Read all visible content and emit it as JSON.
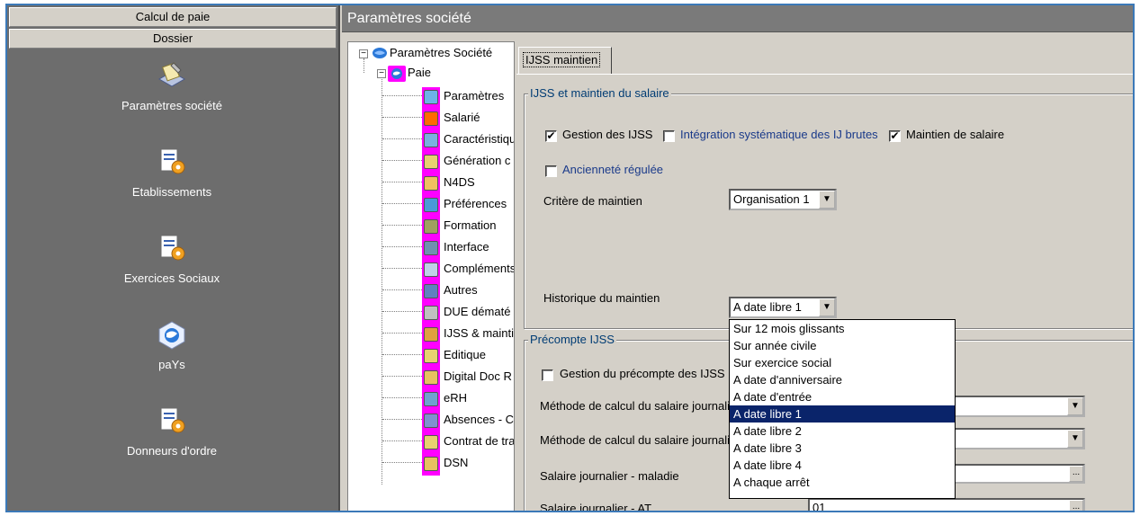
{
  "leftbar": {
    "header_top": "Calcul de paie",
    "header_section": "Dossier",
    "items": [
      {
        "label": "Paramètres société",
        "icon": "settings-wrench-icon"
      },
      {
        "label": "Etablissements",
        "icon": "document-gear-icon"
      },
      {
        "label": "Exercices Sociaux",
        "icon": "document-gear-icon"
      },
      {
        "label": "paYs",
        "icon": "globe-cube-icon"
      },
      {
        "label": "Donneurs d'ordre",
        "icon": "document-gear-icon"
      }
    ]
  },
  "window": {
    "title": "Paramètres société"
  },
  "tree": {
    "root": "Paramètres Société",
    "child": "Paie",
    "items": [
      "Paramètres",
      "Salarié",
      "Caractéristiqu",
      "Génération c",
      "N4DS",
      "Préférences",
      "Formation",
      "Interface",
      "Compléments",
      "Autres",
      "DUE dématé",
      "IJSS & mainti",
      "Editique",
      "Digital Doc R",
      "eRH",
      "Absences - C",
      "Contrat de tra",
      "DSN"
    ]
  },
  "tab": {
    "label": "IJSS maintien"
  },
  "group1": {
    "legend": "IJSS et maintien du salaire",
    "gestion_ijss": {
      "label": "Gestion des IJSS",
      "checked": "✔"
    },
    "integration": {
      "label": "Intégration systématique des IJ brutes",
      "checked": ""
    },
    "maintien": {
      "label": "Maintien de salaire",
      "checked": "✔"
    },
    "anciennete": {
      "label": "Ancienneté régulée",
      "checked": ""
    },
    "critere_label": "Critère de maintien",
    "critere_value": "Organisation 1",
    "historique_label": "Historique du maintien",
    "historique_value": "A date libre 1"
  },
  "group2": {
    "legend": "Précompte IJSS",
    "gestion_precompte": {
      "label": "Gestion du précompte des IJSS",
      "checked": ""
    },
    "methode1_label": "Méthode de calcul du salaire journalier",
    "methode2_label": "Méthode de calcul du salaire journalier",
    "salaire_maladie_label": "Salaire journalier - maladie",
    "salaire_maladie_value": "",
    "salaire_at_label": "Salaire journalier - AT",
    "salaire_at_value": "01"
  },
  "dropdown": {
    "options": [
      "Sur 12 mois glissants",
      "Sur année civile",
      "Sur exercice social",
      "A date d'anniversaire",
      "A date d'entrée",
      "A date libre 1",
      "A date libre 2",
      "A date libre 3",
      "A date libre 4",
      "A chaque arrêt"
    ],
    "selected": "A date libre 1"
  },
  "glyphs": {
    "combo_arrow": "▼",
    "ellipsis": "...",
    "tree_minus": "−"
  }
}
